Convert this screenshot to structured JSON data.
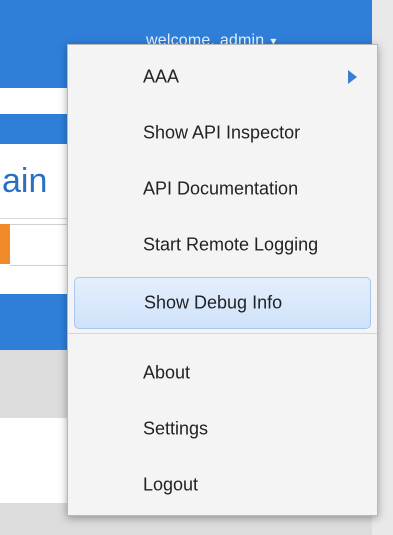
{
  "header": {
    "welcome_text": "welcome, admin",
    "caret": "▾"
  },
  "page": {
    "title_fragment": "ain"
  },
  "menu": {
    "items": [
      {
        "label": "AAA",
        "has_submenu": true
      },
      {
        "label": "Show API Inspector"
      },
      {
        "label": "API Documentation"
      },
      {
        "label": "Start Remote Logging"
      },
      {
        "label": "Show Debug Info",
        "highlighted": true
      },
      {
        "label": "About"
      },
      {
        "label": "Settings"
      },
      {
        "label": "Logout"
      }
    ]
  },
  "colors": {
    "topbar": "#2f7fd8",
    "highlight": "#cfe2fa",
    "submenu_arrow": "#3b7fd4"
  }
}
